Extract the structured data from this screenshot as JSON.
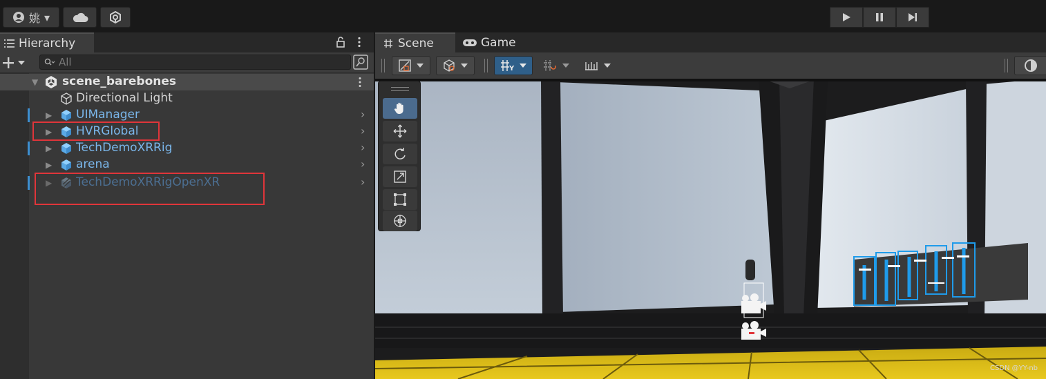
{
  "topbar": {
    "account_label": "姚",
    "account_dropdown": "▾"
  },
  "hierarchy": {
    "tab_title": "Hierarchy",
    "search_placeholder": "All",
    "scene_name": "scene_barebones",
    "items": [
      {
        "label": "Directional Light",
        "color": "#d2d2d2"
      },
      {
        "label": "UIManager",
        "color": "#7ab6ea"
      },
      {
        "label": "HVRGlobal",
        "color": "#7ab6ea"
      },
      {
        "label": "TechDemoXRRig",
        "color": "#7ab6ea"
      },
      {
        "label": "arena",
        "color": "#7ab6ea"
      },
      {
        "label": "TechDemoXRRigOpenXR",
        "color": "#4c6f92"
      }
    ]
  },
  "scene": {
    "tabs": [
      {
        "label": "Scene"
      },
      {
        "label": "Game"
      }
    ],
    "watermark": "CSDN @YY-nb"
  },
  "colors": {
    "prefab_blue": "#7ab6ea",
    "prefab_disabled": "#4c6f92",
    "highlight_red": "#e0353a",
    "floor_yellow": "#e2c21e"
  }
}
